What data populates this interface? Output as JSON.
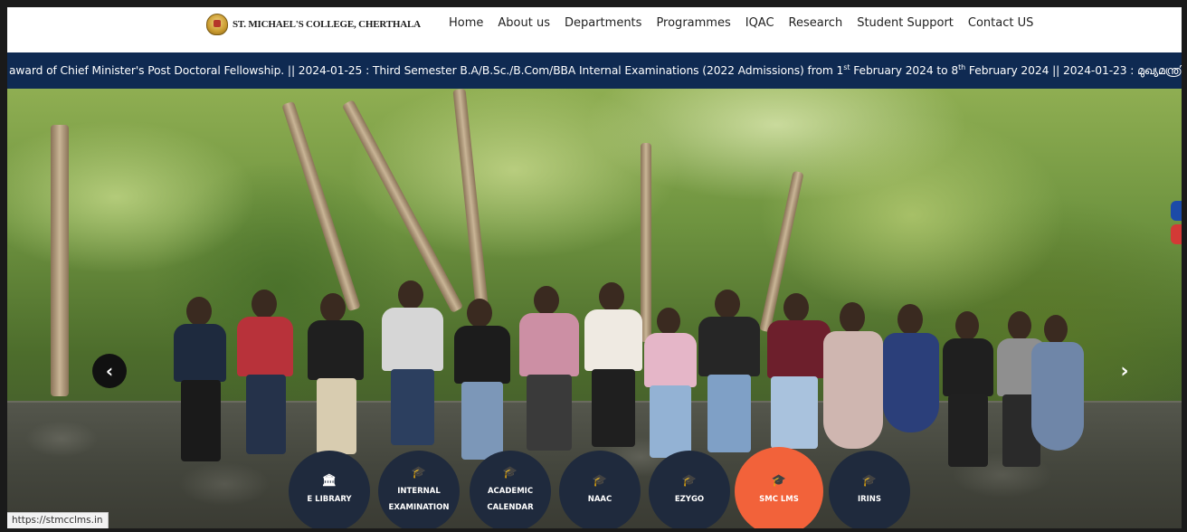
{
  "header": {
    "logo_text": "ST. MICHAEL'S COLLEGE, CHERTHALA",
    "nav": [
      "Home",
      "About us",
      "Departments",
      "Programmes",
      "IQAC",
      "Research",
      "Student Support",
      "Contact US"
    ]
  },
  "ticker": {
    "part1": "award of Chief Minister's Post Doctoral Fellowship.   || 2024-01-25 : Third Semester B.A/B.Sc./B.Com/BBA Internal Examinations (2022 Admissions) from 1",
    "sup1": "st",
    "part2": " February 2024 to 8",
    "sup2": "th",
    "part3": " February 2024   || 2024-01-23 : മുഖ്യമന്ത്രി"
  },
  "slider": {
    "prev_icon": "‹",
    "next_icon": "›"
  },
  "quick_links": [
    {
      "label": "E LIBRARY",
      "icon": "library-icon"
    },
    {
      "label": "INTERNAL EXAMINATION",
      "icon": "graduation-cap-icon"
    },
    {
      "label": "ACADEMIC CALENDAR",
      "icon": "graduation-cap-icon"
    },
    {
      "label": "NAAC",
      "icon": "graduation-cap-icon"
    },
    {
      "label": "EZYGO",
      "icon": "graduation-cap-icon"
    },
    {
      "label": "SMC LMS",
      "icon": "graduation-cap-icon"
    },
    {
      "label": "IRINS",
      "icon": "graduation-cap-icon"
    }
  ],
  "status_bar": "https://stmcclms.in",
  "colors": {
    "ticker_bg": "#0f2a52",
    "quick_bg": "#1f2a3d",
    "quick_active": "#f2623a"
  }
}
